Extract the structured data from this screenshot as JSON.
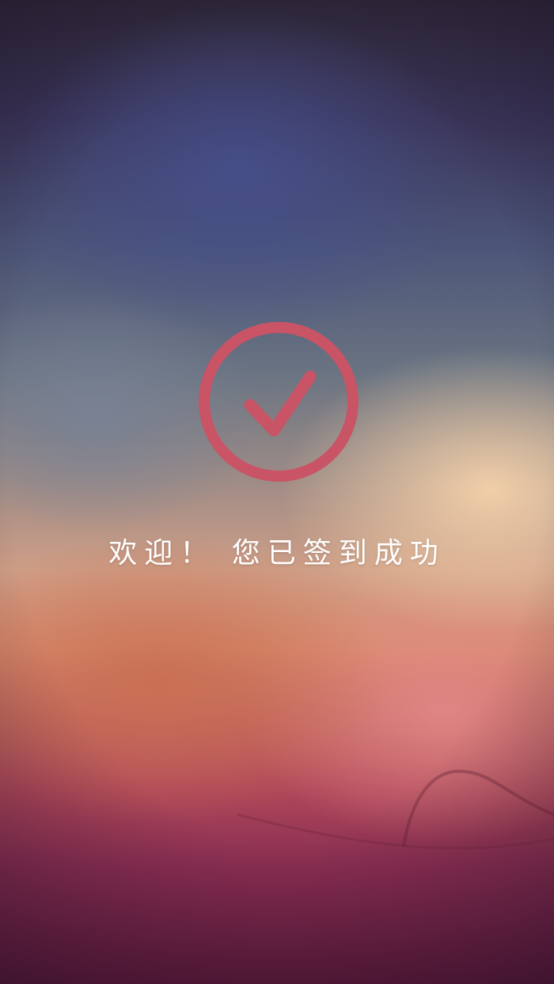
{
  "app": {
    "screen": "check-in-success"
  },
  "status_icon": {
    "icon": "check-circle-icon",
    "color": "#c85466"
  },
  "message": {
    "text": "欢迎！ 您已签到成功",
    "color": "#ffffff"
  }
}
